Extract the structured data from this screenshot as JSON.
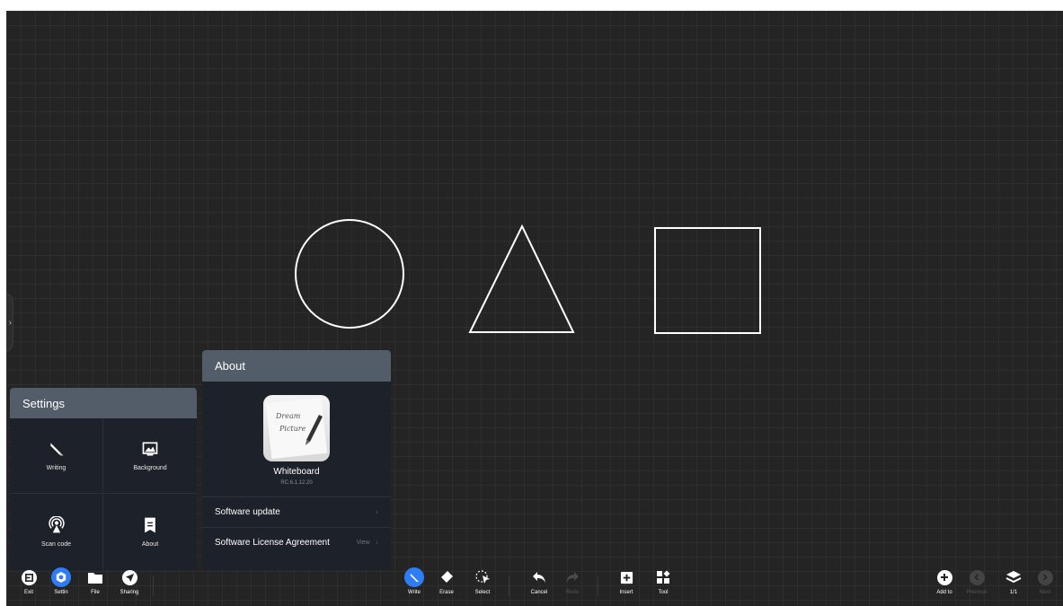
{
  "settings": {
    "title": "Settings",
    "items": [
      {
        "label": "Writing",
        "icon": "pen-icon"
      },
      {
        "label": "Background",
        "icon": "image-icon"
      },
      {
        "label": "Scan code",
        "icon": "broadcast-icon"
      },
      {
        "label": "About",
        "icon": "document-icon"
      }
    ]
  },
  "about": {
    "title": "About",
    "app_icon_text": "Dream Picture",
    "app_name": "Whiteboard",
    "version": "RC.6.1.12.20",
    "rows": [
      {
        "label": "Software update",
        "action": ""
      },
      {
        "label": "Software License Agreement",
        "action": "View"
      }
    ]
  },
  "toolbar": {
    "left": [
      {
        "label": "Exit",
        "icon": "exit-icon"
      },
      {
        "label": "Settin",
        "icon": "settings-icon",
        "active": true
      },
      {
        "label": "File",
        "icon": "folder-icon"
      },
      {
        "label": "Sharing",
        "icon": "send-icon"
      }
    ],
    "center": [
      {
        "label": "Write",
        "icon": "pen-icon",
        "active": true
      },
      {
        "label": "Erase",
        "icon": "eraser-icon"
      },
      {
        "label": "Select",
        "icon": "select-icon"
      },
      {
        "label": "Cancel",
        "icon": "undo-icon"
      },
      {
        "label": "Redo",
        "icon": "redo-icon",
        "disabled": true
      },
      {
        "label": "Insert",
        "icon": "insert-icon"
      },
      {
        "label": "Tool",
        "icon": "tools-icon"
      }
    ],
    "right": [
      {
        "label": "Add to",
        "icon": "plus-icon"
      },
      {
        "label": "Previous",
        "icon": "chevron-left-icon",
        "disabled": true
      },
      {
        "label": "1/1",
        "icon": "layers-icon"
      },
      {
        "label": "Next",
        "icon": "chevron-right-icon",
        "disabled": true
      }
    ]
  },
  "colors": {
    "board": "#242424",
    "panel_header": "#535c69",
    "panel_body": "#1d2129",
    "accent": "#2e7cf6"
  }
}
